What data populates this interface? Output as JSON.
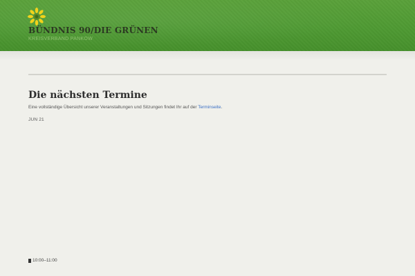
{
  "header": {
    "logo_icon": "sunflower-icon",
    "title": "BÜNDNIS 90/DIE GRÜNEN",
    "subtitle": "KREISVERBAND PANKOW",
    "colors": {
      "green": "#4f9a33",
      "petal": "#f2d21b",
      "center": "#5a8a2a"
    }
  },
  "main": {
    "heading": "Die nächsten Termine",
    "intro_text": "Eine vollständige Übersicht unserer Veranstaltungen und Sitzungen findet Ihr auf der ",
    "intro_link": "Terminseite",
    "intro_end": ".",
    "event": {
      "date": "JUN 21",
      "time_icon": "clock-icon",
      "time": "10:00–11:00"
    }
  }
}
